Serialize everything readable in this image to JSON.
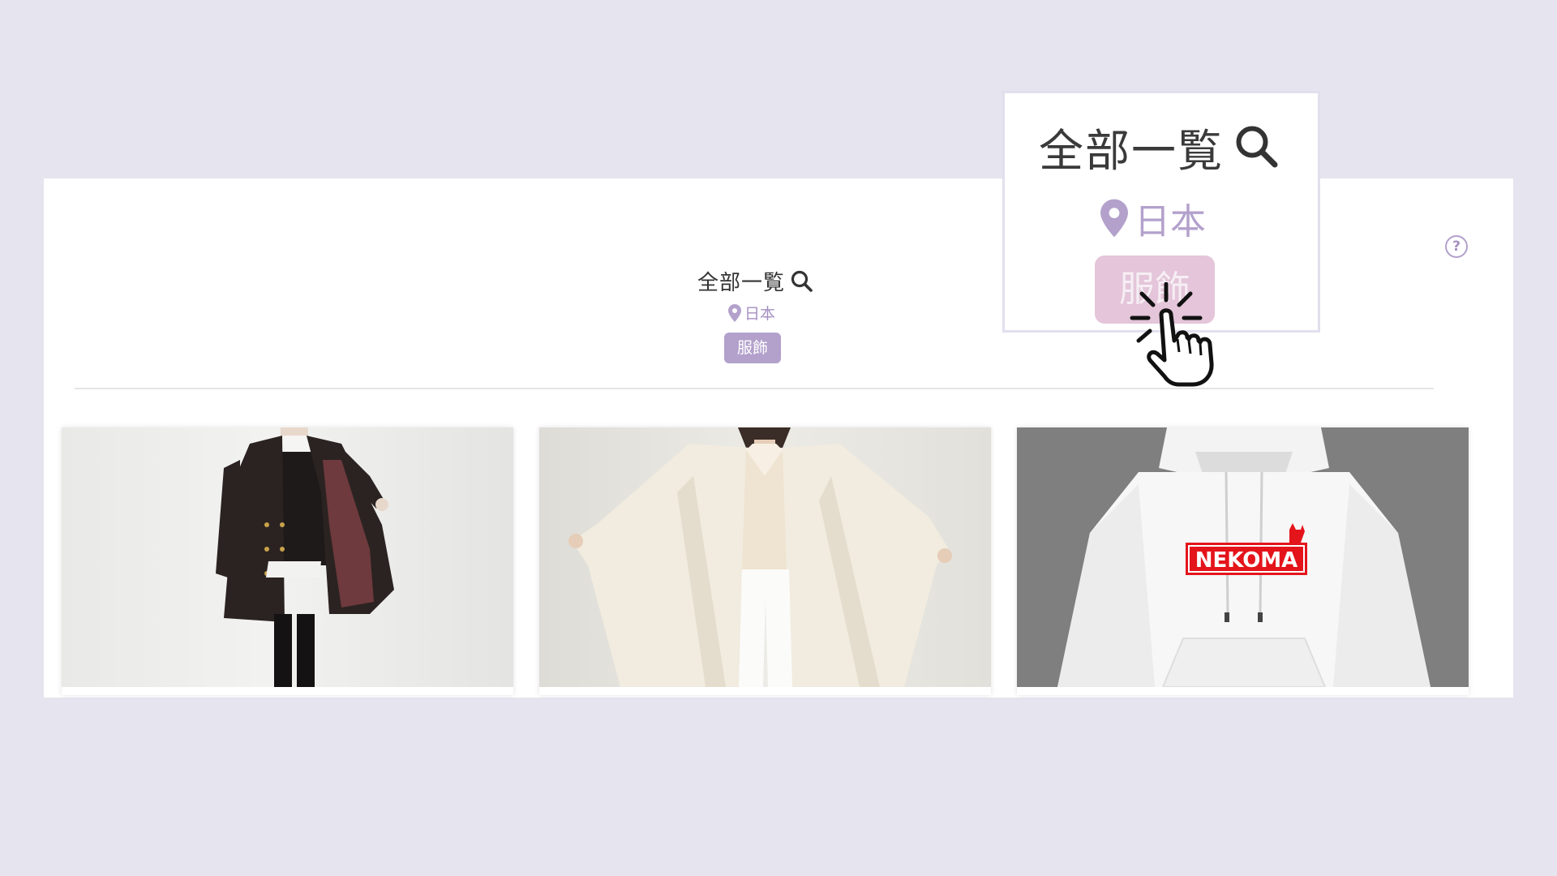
{
  "header": {
    "title": "全部一覧",
    "location": "日本",
    "category_tag": "服飾"
  },
  "zoom_callout": {
    "title": "全部一覧",
    "location": "日本",
    "category_tag": "服飾"
  },
  "help": {
    "symbol": "?"
  },
  "products": [
    {
      "image": "black-coat-photo"
    },
    {
      "image": "cream-cape-coat-photo"
    },
    {
      "image": "white-hoodie-photo",
      "print_text": "NEKOMA"
    }
  ],
  "icons": {
    "search": "search-icon",
    "location": "location-pin-icon",
    "help": "question-circle-icon",
    "cursor": "hand-pointer-click-icon"
  },
  "colors": {
    "background": "#e6e4ef",
    "accent": "#b3a1cc",
    "tag_highlight": "#e4c5d9"
  }
}
